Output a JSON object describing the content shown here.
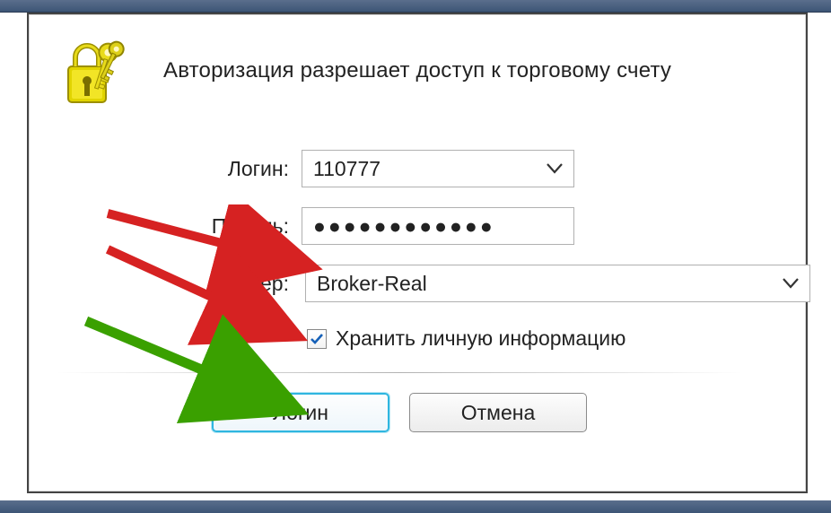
{
  "dialog": {
    "title": "Авторизация разрешает доступ к торговому счету"
  },
  "form": {
    "login_label": "Логин:",
    "login_value": "110777",
    "password_label": "Пароль:",
    "password_value": "●●●●●●●●●●●●",
    "server_label": "Сервер:",
    "server_value": "Broker-Real",
    "remember_label": "Хранить личную информацию",
    "remember_checked": true
  },
  "buttons": {
    "login": "Логин",
    "cancel": "Отмена"
  }
}
